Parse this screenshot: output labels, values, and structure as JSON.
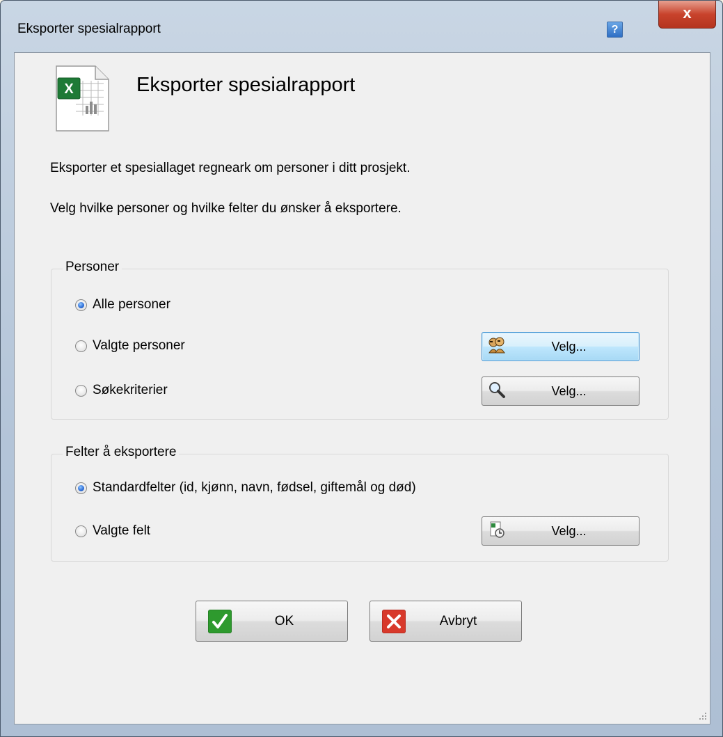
{
  "window": {
    "title": "Eksporter spesialrapport",
    "help_label": "?",
    "close_label": "x"
  },
  "header": {
    "heading": "Eksporter spesialrapport",
    "icon": "excel-document-icon"
  },
  "description": {
    "line1": "Eksporter et spesiallaget regneark om personer i ditt prosjekt.",
    "line2": "Velg hvilke personer og hvilke felter du ønsker å eksportere."
  },
  "persons_group": {
    "legend": "Personer",
    "options": [
      {
        "label": "Alle personer",
        "checked": true
      },
      {
        "label": "Valgte personer",
        "checked": false,
        "button": "Velg...",
        "icon": "people-icon"
      },
      {
        "label": "Søkekriterier",
        "checked": false,
        "button": "Velg...",
        "icon": "magnifier-icon"
      }
    ]
  },
  "fields_group": {
    "legend": "Felter å eksportere",
    "options": [
      {
        "label": "Standardfelter (id, kjønn, navn, fødsel, giftemål og død)",
        "checked": true
      },
      {
        "label": "Valgte felt",
        "checked": false,
        "button": "Velg...",
        "icon": "field-select-icon"
      }
    ]
  },
  "footer": {
    "ok_label": "OK",
    "cancel_label": "Avbryt"
  },
  "colors": {
    "ok_green": "#2e9a2e",
    "cancel_red": "#d8392b",
    "focus_blue": "#3c8fd1"
  }
}
